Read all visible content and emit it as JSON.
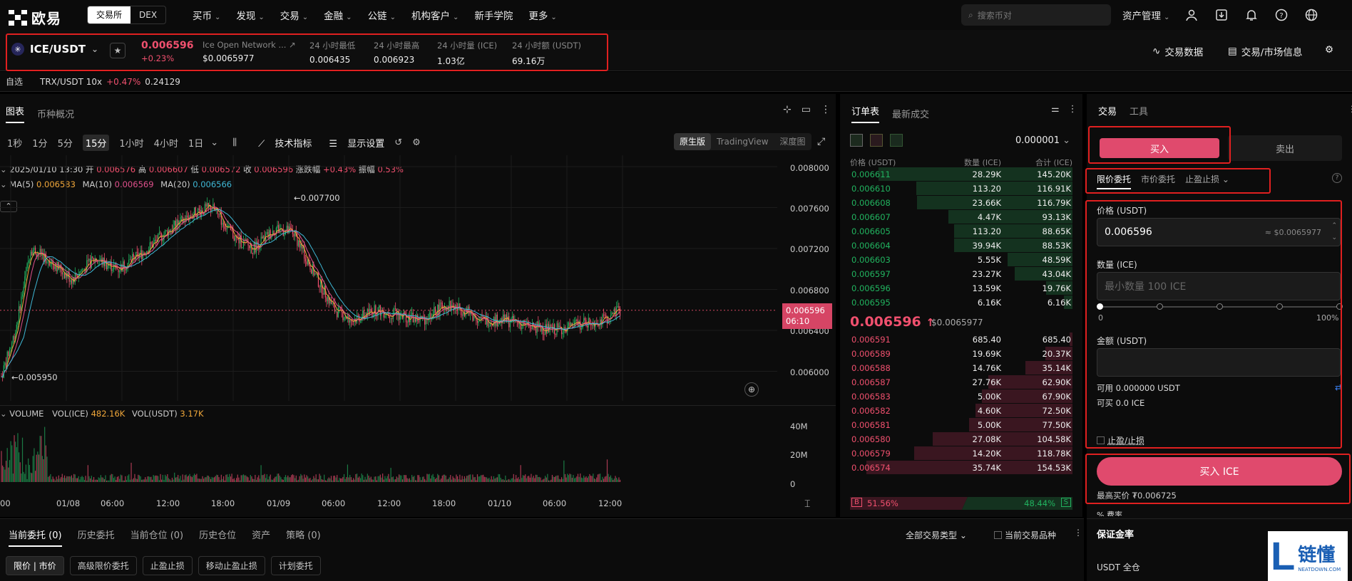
{
  "header": {
    "logo_text": "欧易",
    "seg_exchange": "交易所",
    "seg_dex": "DEX",
    "nav": [
      "买币",
      "发现",
      "交易",
      "金融",
      "公链",
      "机构客户",
      "新手学院",
      "更多"
    ],
    "search_placeholder": "搜索币对",
    "asset_mgmt": "资产管理"
  },
  "ticker": {
    "symbol": "ICE/USDT",
    "price": "0.006596",
    "change": "+0.23%",
    "stats": [
      {
        "label": "Ice Open Network ...",
        "value": "$0.0065977"
      },
      {
        "label": "24 小时最低",
        "value": "0.006435"
      },
      {
        "label": "24 小时最高",
        "value": "0.006923"
      },
      {
        "label": "24 小时量 (ICE)",
        "value": "1.03亿"
      },
      {
        "label": "24 小时额 (USDT)",
        "value": "69.16万"
      }
    ],
    "trade_data": "交易数据",
    "market_info": "交易/市场信息"
  },
  "favorites": {
    "label": "自选",
    "pair": "TRX/USDT 10x",
    "change": "+0.47%",
    "price": "0.24129"
  },
  "chart": {
    "tabs": [
      "图表",
      "币种概况"
    ],
    "intervals": [
      "1秒",
      "1分",
      "5分",
      "15分",
      "1小时",
      "4小时",
      "1日"
    ],
    "indicators": "技术指标",
    "display": "显示设置",
    "types": [
      "原生版",
      "TradingView",
      "深度图"
    ],
    "ohlc": {
      "date": "2025/01/10 13:30",
      "open_lab": "开",
      "open": "0.006576",
      "high_lab": "高",
      "high": "0.006607",
      "low_lab": "低",
      "low": "0.006572",
      "close_lab": "收",
      "close": "0.006596",
      "chg_lab": "涨跌幅",
      "chg": "+0.43%",
      "amp_lab": "振幅",
      "amp": "0.53%"
    },
    "ma": {
      "ma5_lab": "MA(5)",
      "ma5": "0.006583",
      "ma10_lab": "MA(10)",
      "ma10": "0.006569",
      "ma20_lab": "MA(20)",
      "ma20": "0.006566"
    },
    "y_ticks": [
      "0.008000",
      "0.007600",
      "0.007200",
      "0.006800",
      "0.006400",
      "0.006000"
    ],
    "price_tag": "0.006596",
    "countdown": "06:10",
    "high_mark": "0.007700",
    "low_mark": "0.005950",
    "volume": {
      "label": "VOLUME",
      "ice_lab": "VOL(ICE)",
      "ice": "482.16K",
      "usdt_lab": "VOL(USDT)",
      "usdt": "3.17K"
    },
    "vol_ticks": [
      "40M",
      "20M",
      "0"
    ],
    "x_ticks": [
      "00",
      "01/08",
      "06:00",
      "12:00",
      "18:00",
      "01/09",
      "06:00",
      "12:00",
      "18:00",
      "01/10",
      "06:00",
      "12:00"
    ]
  },
  "orderbook": {
    "tabs": [
      "订单表",
      "最新成交"
    ],
    "precision": "0.000001",
    "headers": [
      "价格 (USDT)",
      "数量 (ICE)",
      "合计 (ICE)"
    ],
    "bids": [
      [
        "0.006611",
        "28.29K",
        "145.20K"
      ],
      [
        "0.006610",
        "113.20",
        "116.91K"
      ],
      [
        "0.006608",
        "23.66K",
        "116.79K"
      ],
      [
        "0.006607",
        "4.47K",
        "93.13K"
      ],
      [
        "0.006605",
        "113.20",
        "88.65K"
      ],
      [
        "0.006604",
        "39.94K",
        "88.53K"
      ],
      [
        "0.006603",
        "5.55K",
        "48.59K"
      ],
      [
        "0.006597",
        "23.27K",
        "43.04K"
      ],
      [
        "0.006596",
        "13.59K",
        "19.76K"
      ],
      [
        "0.006595",
        "6.16K",
        "6.16K"
      ]
    ],
    "last_price": "0.006596",
    "last_usd": "$0.0065977",
    "asks": [
      [
        "0.006591",
        "685.40",
        "685.40"
      ],
      [
        "0.006589",
        "19.69K",
        "20.37K"
      ],
      [
        "0.006588",
        "14.76K",
        "35.14K"
      ],
      [
        "0.006587",
        "27.76K",
        "62.90K"
      ],
      [
        "0.006583",
        "5.00K",
        "67.90K"
      ],
      [
        "0.006582",
        "4.60K",
        "72.50K"
      ],
      [
        "0.006581",
        "5.00K",
        "77.50K"
      ],
      [
        "0.006580",
        "27.08K",
        "104.58K"
      ],
      [
        "0.006579",
        "14.20K",
        "118.78K"
      ],
      [
        "0.006574",
        "35.74K",
        "154.53K"
      ]
    ],
    "buy_pct": "51.56%",
    "sell_pct": "48.44%",
    "buy_lab": "B",
    "sell_lab": "S"
  },
  "trade": {
    "tabs": [
      "交易",
      "工具"
    ],
    "buy": "买入",
    "sell": "卖出",
    "order_types": [
      "限价委托",
      "市价委托",
      "止盈止损"
    ],
    "price_label": "价格 (USDT)",
    "price_value": "0.006596",
    "price_usd": "≈ $0.0065977",
    "qty_label": "数量 (ICE)",
    "qty_placeholder": "最小数量 100 ICE",
    "slider_min": "0",
    "slider_max": "100%",
    "amount_label": "金额 (USDT)",
    "available": "可用 0.000000 USDT",
    "can_buy": "可买 0.0 ICE",
    "tpsl": "止盈/止损",
    "buy_button": "买入 ICE",
    "max_price": "最高买价 ₮0.006725",
    "fee_label": "% 费率",
    "margin_title": "保证金率",
    "margin_mode": "USDT 全仓"
  },
  "bottom": {
    "tabs": [
      "当前委托 (0)",
      "历史委托",
      "当前仓位 (0)",
      "历史仓位",
      "资产",
      "策略 (0)"
    ],
    "filter": "全部交易类型",
    "current_only": "当前交易品种",
    "pills": [
      "限价 | 市价",
      "高级限价委托",
      "止盈止损",
      "移动止盈止损",
      "计划委托"
    ]
  },
  "watermark": {
    "char": "L",
    "text": "链懂",
    "sub": "NEATDOWN.COM"
  },
  "colors": {
    "up": "#21b35f",
    "down": "#f0506e",
    "accent": "#e04a6d",
    "ma5": "#f0a73a",
    "ma10": "#e0508c",
    "ma20": "#3fb8d6"
  }
}
